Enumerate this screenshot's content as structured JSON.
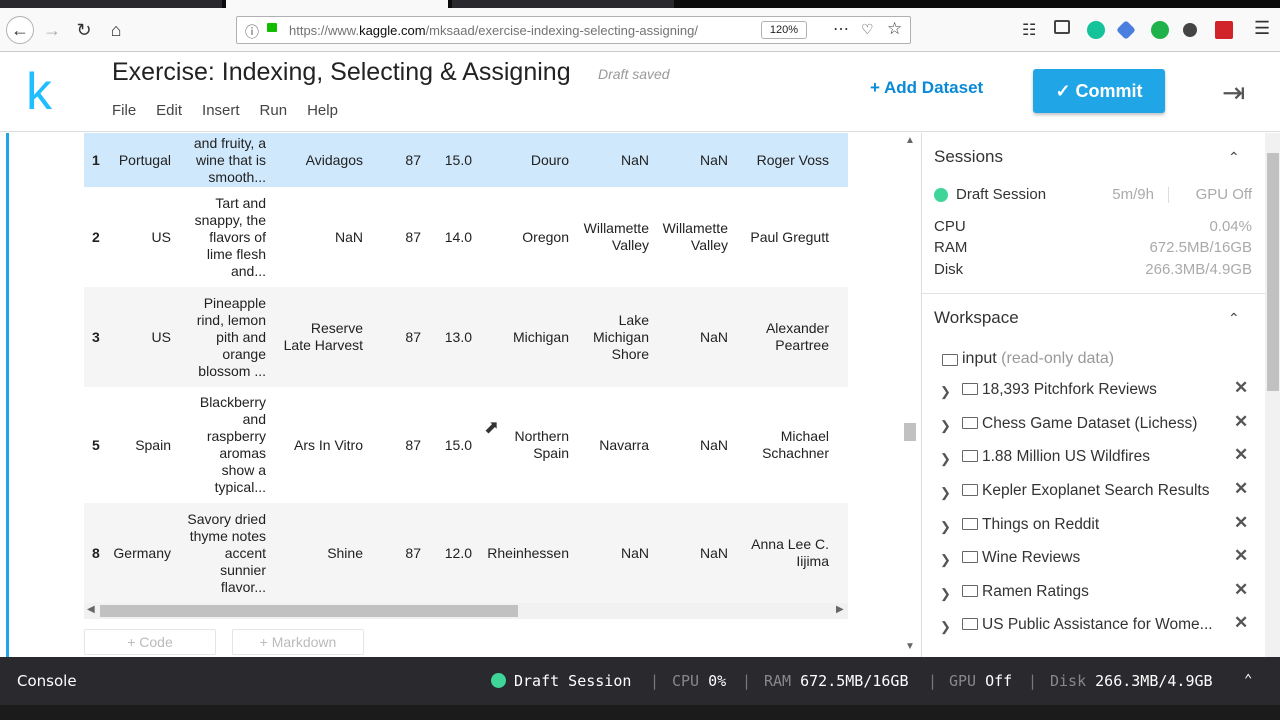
{
  "browser": {
    "url_prefix": "https://www.",
    "url_domain": "kaggle.com",
    "url_path": "/mksaad/exercise-indexing-selecting-assigning/",
    "zoom": "120%"
  },
  "header": {
    "logo": "k",
    "title": "Exercise: Indexing, Selecting & Assigning",
    "status": "Draft saved",
    "menu": [
      "File",
      "Edit",
      "Insert",
      "Run",
      "Help"
    ],
    "add_dataset": "+ Add Dataset",
    "commit": "✓ Commit"
  },
  "table": {
    "rows": [
      {
        "idx": "1",
        "country": "Portugal",
        "desc": [
          "and fruity, a",
          "wine that is",
          "smooth..."
        ],
        "designation": [
          "Avidagos"
        ],
        "points": "87",
        "price": "15.0",
        "province": [
          "Douro"
        ],
        "region1": [
          "NaN"
        ],
        "region2": [
          "NaN"
        ],
        "taster": [
          "Roger Voss"
        ]
      },
      {
        "idx": "2",
        "country": "US",
        "desc": [
          "Tart and",
          "snappy, the",
          "flavors of",
          "lime flesh",
          "and..."
        ],
        "designation": [
          "NaN"
        ],
        "points": "87",
        "price": "14.0",
        "province": [
          "Oregon"
        ],
        "region1": [
          "Willamette",
          "Valley"
        ],
        "region2": [
          "Willamette",
          "Valley"
        ],
        "taster": [
          "Paul Gregutt"
        ]
      },
      {
        "idx": "3",
        "country": "US",
        "desc": [
          "Pineapple",
          "rind, lemon",
          "pith and",
          "orange",
          "blossom ..."
        ],
        "designation": [
          "Reserve",
          "Late Harvest"
        ],
        "points": "87",
        "price": "13.0",
        "province": [
          "Michigan"
        ],
        "region1": [
          "Lake",
          "Michigan",
          "Shore"
        ],
        "region2": [
          "NaN"
        ],
        "taster": [
          "Alexander",
          "Peartree"
        ]
      },
      {
        "idx": "5",
        "country": "Spain",
        "desc": [
          "Blackberry",
          "and",
          "raspberry",
          "aromas",
          "show a",
          "typical..."
        ],
        "designation": [
          "Ars In Vitro"
        ],
        "points": "87",
        "price": "15.0",
        "province": [
          "Northern",
          "Spain"
        ],
        "region1": [
          "Navarra"
        ],
        "region2": [
          "NaN"
        ],
        "taster": [
          "Michael",
          "Schachner"
        ]
      },
      {
        "idx": "8",
        "country": "Germany",
        "desc": [
          "Savory dried",
          "thyme notes",
          "accent",
          "sunnier",
          "flavor..."
        ],
        "designation": [
          "Shine"
        ],
        "points": "87",
        "price": "12.0",
        "province": [
          "Rheinhessen"
        ],
        "region1": [
          "NaN"
        ],
        "region2": [
          "NaN"
        ],
        "taster": [
          "Anna Lee C.",
          "Iijima"
        ]
      }
    ]
  },
  "cell_buttons": {
    "code": "+ Code",
    "markdown": "+ Markdown"
  },
  "sessions": {
    "title": "Sessions",
    "session_name": "Draft Session",
    "session_time": "5m/9h",
    "gpu": "GPU Off",
    "cpu_label": "CPU",
    "cpu_value": "0.04%",
    "ram_label": "RAM",
    "ram_value": "672.5MB/16GB",
    "disk_label": "Disk",
    "disk_value": "266.3MB/4.9GB"
  },
  "workspace": {
    "title": "Workspace",
    "input_label": "input",
    "input_note": "(read-only data)",
    "datasets": [
      "18,393 Pitchfork Reviews",
      "Chess Game Dataset (Lichess)",
      "1.88 Million US Wildfires",
      "Kepler Exoplanet Search Results",
      "Things on Reddit",
      "Wine Reviews",
      "Ramen Ratings",
      "US Public Assistance for Wome..."
    ]
  },
  "console": {
    "label": "Console",
    "session": "Draft Session",
    "cpu_label": "CPU",
    "cpu": "0%",
    "ram_label": "RAM",
    "ram": "672.5MB/16GB",
    "gpu_label": "GPU",
    "gpu": "Off",
    "disk_label": "Disk",
    "disk": "266.3MB/4.9GB"
  },
  "colors": {
    "accent": "#20a6e6",
    "brand": "#20beff",
    "session_green": "#3ed598",
    "selected_row": "#cfe8fc"
  }
}
